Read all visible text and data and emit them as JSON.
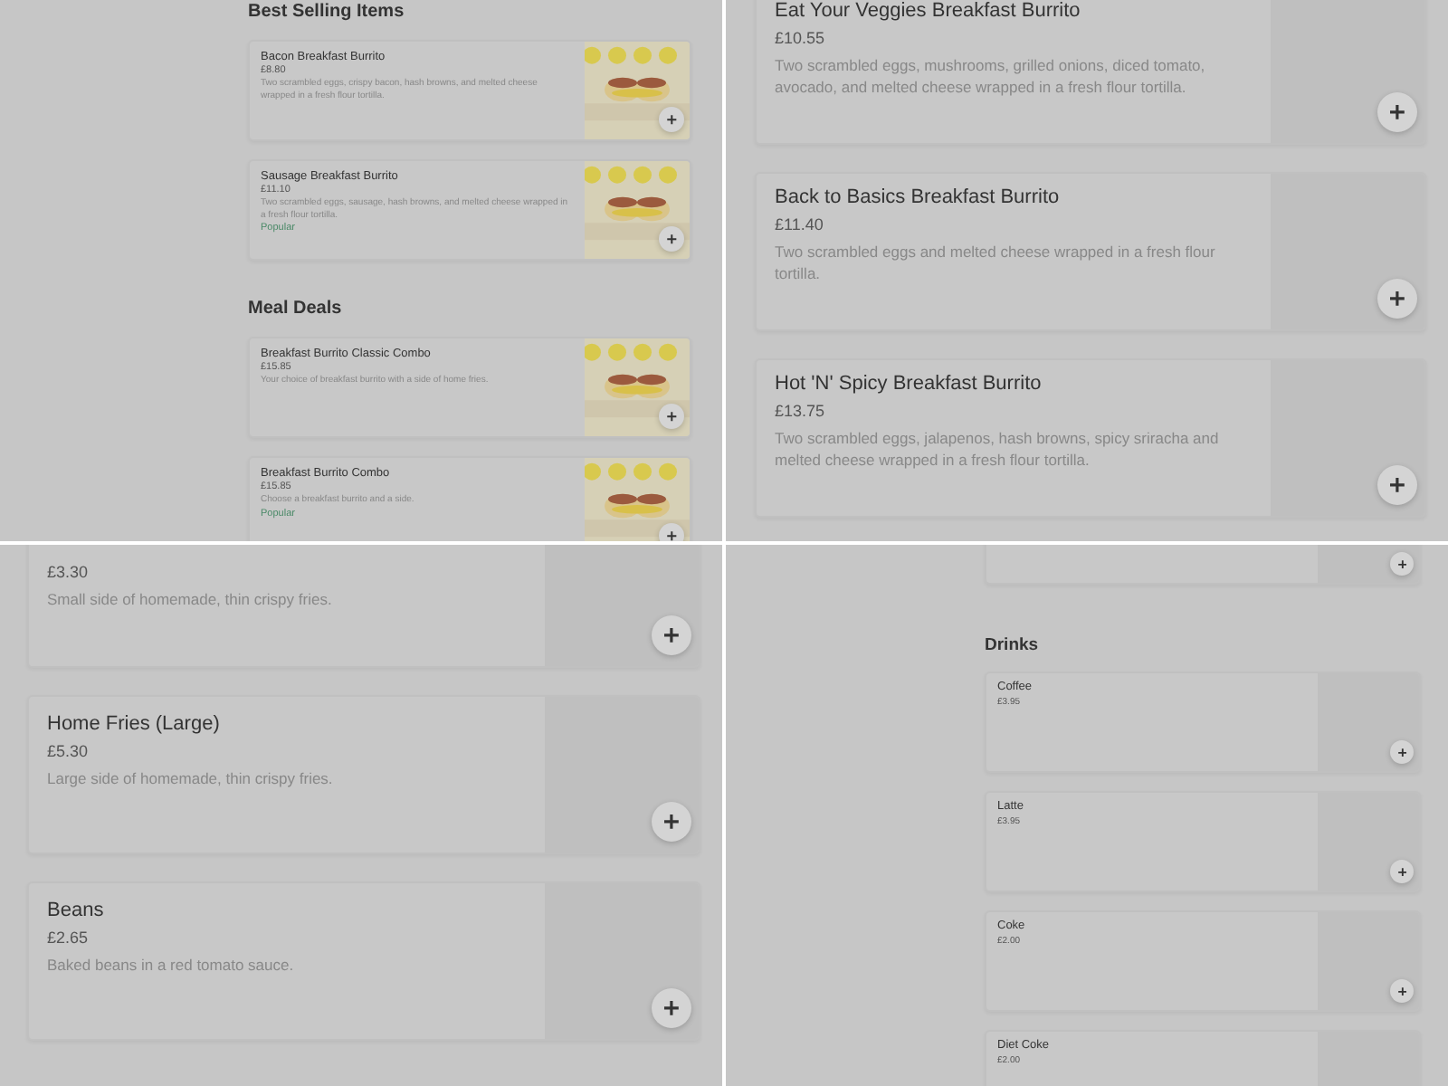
{
  "panels": [
    {
      "sections": [
        {
          "heading": "Best Selling Items",
          "items": [
            {
              "title": "Bacon Breakfast Burrito",
              "price": "£8.80",
              "description": "Two scrambled eggs, crispy bacon, hash browns, and melted cheese wrapped in a fresh flour tortilla."
            },
            {
              "title": "Sausage Breakfast Burrito",
              "price": "£11.10",
              "description": "Two scrambled eggs, sausage, hash browns, and melted cheese wrapped in a fresh flour tortilla.",
              "badge": "Popular"
            }
          ]
        },
        {
          "heading": "Meal Deals",
          "items": [
            {
              "title": "Breakfast Burrito Classic Combo",
              "price": "£15.85",
              "description": "Your choice of breakfast burrito with a side of home fries."
            },
            {
              "title": "Breakfast Burrito Combo",
              "price": "£15.85",
              "description": "Choose a breakfast burrito and a side.",
              "badge": "Popular"
            }
          ]
        }
      ]
    },
    {
      "sections": [
        {
          "items": [
            {
              "kind": "plain",
              "title": "Eat Your Veggies Breakfast Burrito",
              "price": "£10.55",
              "description": "Two scrambled eggs, mushrooms, grilled onions, diced tomato, avocado, and melted cheese wrapped in a fresh flour tortilla."
            },
            {
              "kind": "plain",
              "title": "Back to Basics Breakfast Burrito",
              "price": "£11.40",
              "description": "Two scrambled eggs and melted cheese wrapped in a fresh flour tortilla."
            },
            {
              "kind": "plain",
              "title": "Hot 'N' Spicy Breakfast Burrito",
              "price": "£13.75",
              "description": "Two scrambled eggs, jalapenos, hash browns, spicy sriracha and melted cheese wrapped in a fresh flour tortilla."
            }
          ]
        }
      ]
    },
    {
      "sections": [
        {
          "items": [
            {
              "kind": "plain",
              "price": "£3.30",
              "description": "Small side of homemade, thin crispy fries."
            },
            {
              "kind": "plain",
              "title": "Home Fries (Large)",
              "price": "£5.30",
              "description": "Large side of homemade, thin crispy fries."
            },
            {
              "kind": "plain",
              "title": "Beans",
              "price": "£2.65",
              "description": "Baked beans in a red tomato sauce."
            }
          ]
        }
      ]
    },
    {
      "sections": [
        {
          "items": [
            {
              "kind": "plain"
            }
          ]
        },
        {
          "heading": "Drinks",
          "items": [
            {
              "kind": "plain",
              "title": "Coffee",
              "price": "£3.95"
            },
            {
              "kind": "plain",
              "title": "Latte",
              "price": "£3.95"
            },
            {
              "kind": "plain",
              "title": "Coke",
              "price": "£2.00"
            },
            {
              "kind": "plain",
              "title": "Diet Coke",
              "price": "£2.00"
            }
          ]
        }
      ]
    }
  ]
}
